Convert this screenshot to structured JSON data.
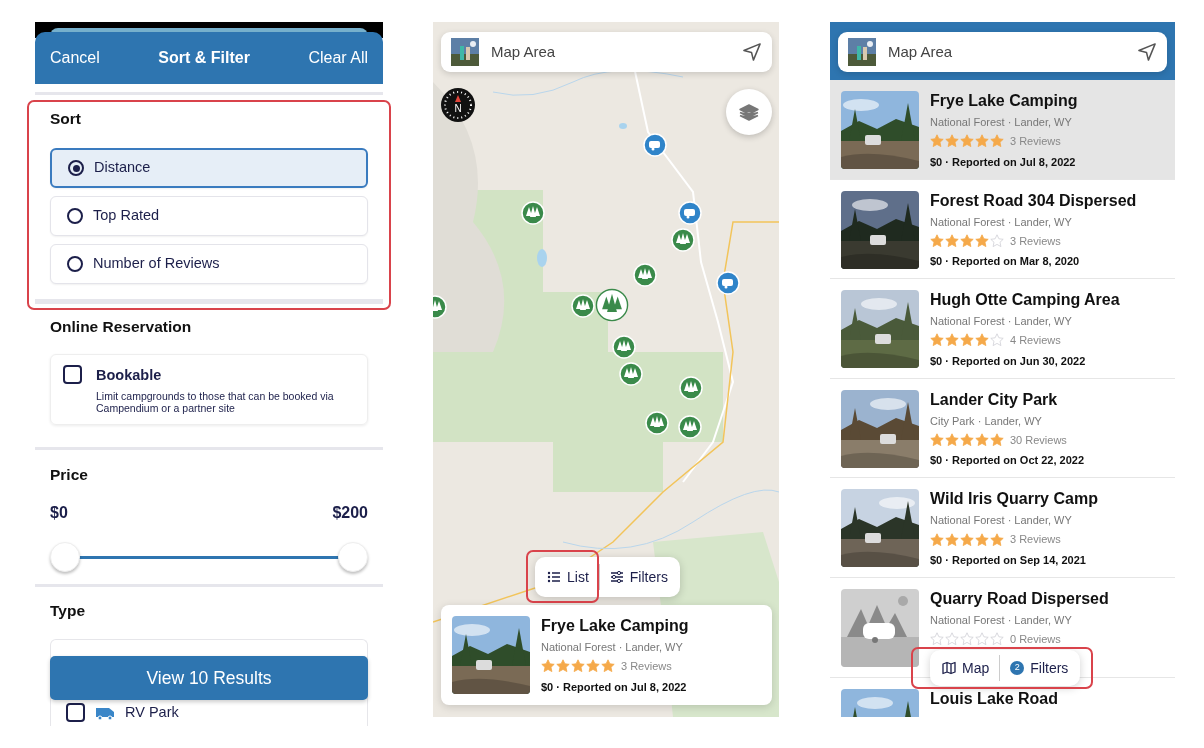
{
  "filter_sheet": {
    "header": {
      "cancel": "Cancel",
      "title": "Sort & Filter",
      "clear": "Clear All"
    },
    "sort": {
      "title": "Sort",
      "highlighted": true,
      "options": [
        {
          "label": "Distance",
          "selected": true
        },
        {
          "label": "Top Rated",
          "selected": false
        },
        {
          "label": "Number of Reviews",
          "selected": false
        }
      ]
    },
    "online_reservation": {
      "title": "Online Reservation",
      "options": [
        {
          "label": "Bookable",
          "description": "Limit campgrounds to those that can be booked via Campendium or a partner site",
          "checked": false
        }
      ]
    },
    "price": {
      "title": "Price",
      "min": "$0",
      "max": "$200",
      "range": [
        {
          "level": 0
        },
        {
          "level": 1
        }
      ]
    },
    "type": {
      "title": "Type",
      "options": [
        {
          "label": "RV Park",
          "kind": "rv",
          "checked": false
        }
      ]
    },
    "view_button": "View 10 Results"
  },
  "map_screen": {
    "search": {
      "text": "Map Area"
    },
    "compass": "N",
    "toggle": {
      "buttons": [
        {
          "label": "List",
          "kind": "list",
          "highlighted": true
        },
        {
          "label": "Filters",
          "kind": "filters"
        }
      ]
    },
    "preview": {
      "name": "Frye Lake Camping",
      "category": "National Forest · Lander, WY",
      "stars": 5,
      "reviews": "3 Reviews",
      "details": "$0 · Reported on Jul 8, 2022"
    }
  },
  "list_screen": {
    "search": {
      "text": "Map Area"
    },
    "campsites": [
      {
        "name": "Frye Lake Camping",
        "category": "National Forest · Lander, WY",
        "stars": 5,
        "reviews": "3 Reviews",
        "details": "$0 · Reported on Jul 8, 2022",
        "selected": true
      },
      {
        "name": "Forest Road 304 Dispersed",
        "category": "National Forest · Lander, WY",
        "stars": 4,
        "reviews": "3 Reviews",
        "details": "$0 · Reported on Mar 8, 2020",
        "selected": false
      },
      {
        "name": "Hugh Otte Camping Area",
        "category": "National Forest · Lander, WY",
        "stars": 4,
        "reviews": "4 Reviews",
        "details": "$0 · Reported on Jun 30, 2022",
        "selected": false
      },
      {
        "name": "Lander City Park",
        "category": "City Park · Lander, WY",
        "stars": 5,
        "reviews": "30 Reviews",
        "details": "$0 · Reported on Oct 22, 2022",
        "selected": false
      },
      {
        "name": "Wild Iris Quarry Camp",
        "category": "National Forest · Lander, WY",
        "stars": 5,
        "reviews": "3 Reviews",
        "details": "$0 · Reported on Sep 14, 2021",
        "selected": false
      },
      {
        "name": "Quarry Road Dispersed",
        "category": "National Forest · Lander, WY",
        "stars": 0,
        "reviews": "0 Reviews",
        "kind": "placeholder",
        "selected": false
      },
      {
        "name": "Louis Lake Road",
        "selected": false
      }
    ],
    "toggle": {
      "highlighted": true,
      "buttons": [
        {
          "label": "Map",
          "kind": "map"
        },
        {
          "label": "Filters",
          "kind": "filters",
          "badge": "2"
        }
      ]
    }
  }
}
